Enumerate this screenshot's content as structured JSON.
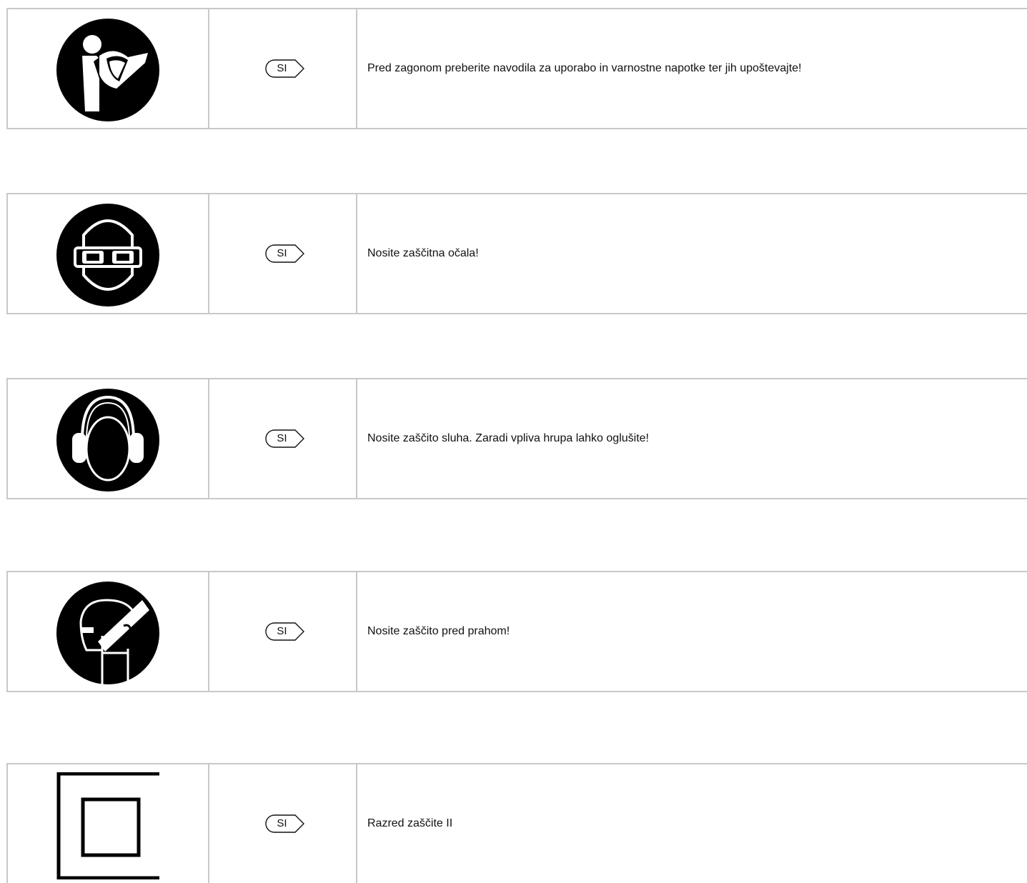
{
  "rows": [
    {
      "icon": "read-manual-icon",
      "lang": "SI",
      "text": "Pred zagonom preberite navodila za uporabo in varnostne napotke ter jih upoštevajte!"
    },
    {
      "icon": "safety-goggles-icon",
      "lang": "SI",
      "text": "Nosite zaščitna očala!"
    },
    {
      "icon": "ear-protection-icon",
      "lang": "SI",
      "text": "Nosite zaščito sluha. Zaradi vpliva hrupa lahko oglušite!"
    },
    {
      "icon": "dust-mask-icon",
      "lang": "SI",
      "text": "Nosite zaščito pred prahom!"
    },
    {
      "icon": "protection-class-ii-icon",
      "lang": "SI",
      "text": "Razred zaščite II"
    }
  ]
}
